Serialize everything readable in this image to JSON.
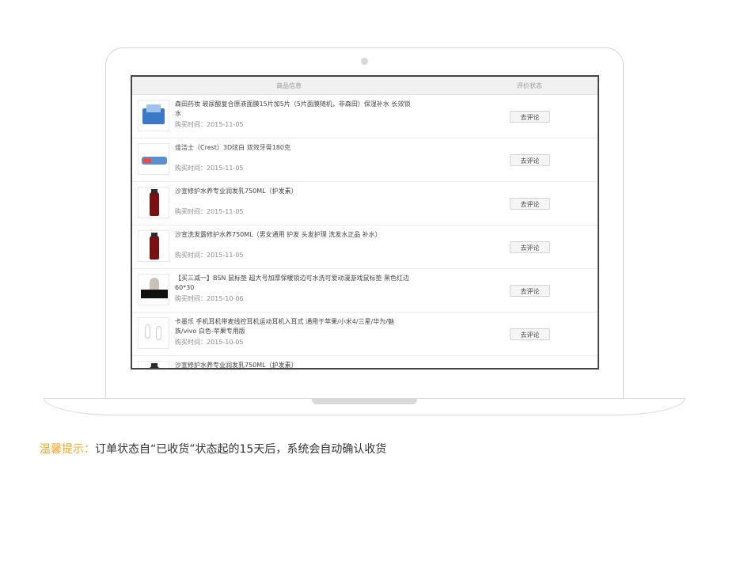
{
  "table": {
    "header_goods": "商品信息",
    "header_status": "评价状态",
    "rows": [
      {
        "name": "森田药妆 玻尿酸复合原液面膜15片加5片（5片面膜随机，非森田）保湿补水 长效锁水",
        "date_label": "购买时间：",
        "date": "2015-11-05",
        "button": "去评论",
        "thumb": "mask-box-icon"
      },
      {
        "name": "佳洁士（Crest）3D炫白 双效牙膏180克",
        "date_label": "购买时间：",
        "date": "2015-11-05",
        "button": "去评论",
        "thumb": "toothpaste-icon"
      },
      {
        "name": "沙宣修护水养专业润发乳750ML（护发素）",
        "date_label": "购买时间：",
        "date": "2015-11-05",
        "button": "去评论",
        "thumb": "bottle-icon"
      },
      {
        "name": "沙宣洗发露修护水养750ML（男女通用 护发 头发护理 洗发水正品 补水）",
        "date_label": "购买时间：",
        "date": "2015-11-05",
        "button": "去评论",
        "thumb": "bottle-icon"
      },
      {
        "name": "【买三减一】BSN 鼠标垫 超大号加厚保暖锁边可水洗可爱动漫游戏鼠标垫 黑色红边60*30",
        "date_label": "购买时间：",
        "date": "2015-10-06",
        "button": "去评论",
        "thumb": "mousepad-icon"
      },
      {
        "name": "卡墨乐 手机耳机带麦线控耳机运动耳机入耳式 通用于苹果/小米4/三星/华为/魅族/vivo 白色-苹果专用版",
        "date_label": "购买时间：",
        "date": "2015-10-05",
        "button": "去评论",
        "thumb": "earphone-icon"
      },
      {
        "name": "沙宣修护水养专业润发乳750ML（护发素）",
        "date_label": "",
        "date": "",
        "button": "",
        "thumb": "bottle-icon"
      }
    ]
  },
  "tip": {
    "label": "温馨提示：",
    "text": "订单状态自“已收货”状态起的15天后，系统会自动确认收货"
  },
  "colors": {
    "accent": "#f5a623",
    "screen_border": "#444444"
  }
}
